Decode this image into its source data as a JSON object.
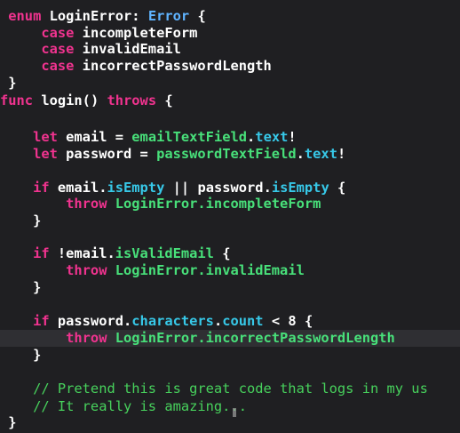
{
  "editor": {
    "lines": [
      {
        "tokens": [
          {
            "t": " enum ",
            "c": "kw"
          },
          {
            "t": "LoginError",
            "c": "id"
          },
          {
            "t": ": ",
            "c": "id"
          },
          {
            "t": "Error",
            "c": "type"
          },
          {
            "t": " {",
            "c": "id"
          }
        ]
      },
      {
        "tokens": [
          {
            "t": "     case ",
            "c": "kw"
          },
          {
            "t": "incompleteForm",
            "c": "id"
          }
        ]
      },
      {
        "tokens": [
          {
            "t": "     case ",
            "c": "kw"
          },
          {
            "t": "invalidEmail",
            "c": "id"
          }
        ]
      },
      {
        "tokens": [
          {
            "t": "     case ",
            "c": "kw"
          },
          {
            "t": "incorrectPasswordLength",
            "c": "id"
          }
        ]
      },
      {
        "tokens": [
          {
            "t": " }",
            "c": "id"
          }
        ]
      },
      {
        "tokens": [
          {
            "t": "func ",
            "c": "kw"
          },
          {
            "t": "login() ",
            "c": "id"
          },
          {
            "t": "throws",
            "c": "kw"
          },
          {
            "t": " {",
            "c": "id"
          }
        ]
      },
      {
        "tokens": []
      },
      {
        "tokens": [
          {
            "t": "    let ",
            "c": "kw"
          },
          {
            "t": "email = ",
            "c": "id"
          },
          {
            "t": "emailTextField",
            "c": "green"
          },
          {
            "t": ".",
            "c": "id"
          },
          {
            "t": "text",
            "c": "prop"
          },
          {
            "t": "!",
            "c": "id"
          }
        ]
      },
      {
        "tokens": [
          {
            "t": "    let ",
            "c": "kw"
          },
          {
            "t": "password = ",
            "c": "id"
          },
          {
            "t": "passwordTextField",
            "c": "green"
          },
          {
            "t": ".",
            "c": "id"
          },
          {
            "t": "text",
            "c": "prop"
          },
          {
            "t": "!",
            "c": "id"
          }
        ]
      },
      {
        "tokens": []
      },
      {
        "tokens": [
          {
            "t": "    if ",
            "c": "kw"
          },
          {
            "t": "email.",
            "c": "id"
          },
          {
            "t": "isEmpty",
            "c": "prop"
          },
          {
            "t": " || ",
            "c": "id"
          },
          {
            "t": "password.",
            "c": "id"
          },
          {
            "t": "isEmpty",
            "c": "prop"
          },
          {
            "t": " {",
            "c": "id"
          }
        ]
      },
      {
        "tokens": [
          {
            "t": "        throw ",
            "c": "kw"
          },
          {
            "t": "LoginError.incompleteForm",
            "c": "green"
          }
        ]
      },
      {
        "tokens": [
          {
            "t": "    }",
            "c": "id"
          }
        ]
      },
      {
        "tokens": []
      },
      {
        "tokens": [
          {
            "t": "    if ",
            "c": "kw"
          },
          {
            "t": "!email.",
            "c": "id"
          },
          {
            "t": "isValidEmail",
            "c": "green"
          },
          {
            "t": " {",
            "c": "id"
          }
        ]
      },
      {
        "tokens": [
          {
            "t": "        throw ",
            "c": "kw"
          },
          {
            "t": "LoginError.invalidEmail",
            "c": "green"
          }
        ]
      },
      {
        "tokens": [
          {
            "t": "    }",
            "c": "id"
          }
        ]
      },
      {
        "tokens": []
      },
      {
        "tokens": [
          {
            "t": "    if ",
            "c": "kw"
          },
          {
            "t": "password.",
            "c": "id"
          },
          {
            "t": "characters",
            "c": "prop"
          },
          {
            "t": ".",
            "c": "id"
          },
          {
            "t": "count",
            "c": "prop"
          },
          {
            "t": " < ",
            "c": "id"
          },
          {
            "t": "8",
            "c": "num"
          },
          {
            "t": " {",
            "c": "id"
          }
        ]
      },
      {
        "tokens": [
          {
            "t": "        throw ",
            "c": "kw"
          },
          {
            "t": "LoginError.incorrectPasswordLength",
            "c": "green"
          }
        ],
        "highlight": true
      },
      {
        "tokens": [
          {
            "t": "    }",
            "c": "id"
          }
        ]
      },
      {
        "tokens": []
      },
      {
        "tokens": [
          {
            "t": "    // Pretend this is great code that logs in my us",
            "c": "comment"
          }
        ]
      },
      {
        "tokens": [
          {
            "t": "    // It really is amazing...",
            "c": "comment"
          }
        ]
      },
      {
        "tokens": [
          {
            "t": " }",
            "c": "id"
          }
        ]
      }
    ]
  },
  "colors": {
    "background": "#1f1f22",
    "keyword": "#f0338f",
    "identifier": "#ffffff",
    "type": "#5fb3ff",
    "property": "#37c8e8",
    "project_symbol": "#48e07a",
    "comment": "#47d15c",
    "current_line": "#2f2f33"
  }
}
